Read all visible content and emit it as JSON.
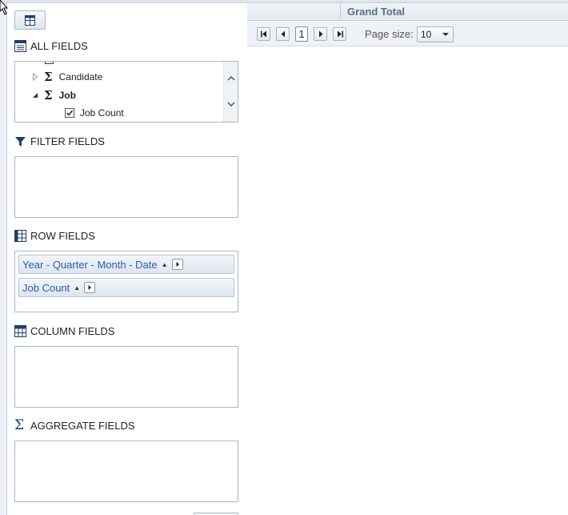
{
  "sections": {
    "all_fields": "ALL FIELDS",
    "filter_fields": "FILTER FIELDS",
    "row_fields": "ROW FIELDS",
    "column_fields": "COLUMN FIELDS",
    "aggregate_fields": "AGGREGATE FIELDS"
  },
  "tree": {
    "items": [
      {
        "label": "Candidate",
        "expanded": false
      },
      {
        "label": "Job",
        "expanded": true
      }
    ],
    "job_child": {
      "label": "Job Count",
      "checked": true
    }
  },
  "row_chips": [
    {
      "label": "Year - Quarter - Month - Date"
    },
    {
      "label": "Job Count"
    }
  ],
  "grid": {
    "grand_total": "Grand Total"
  },
  "pager": {
    "current_page": "1",
    "page_size_label": "Page size:",
    "page_size_value": "10"
  },
  "colors": {
    "chip_text": "#2a5ea8",
    "border": "#a9b8c8",
    "header_text": "#5a6e84"
  }
}
